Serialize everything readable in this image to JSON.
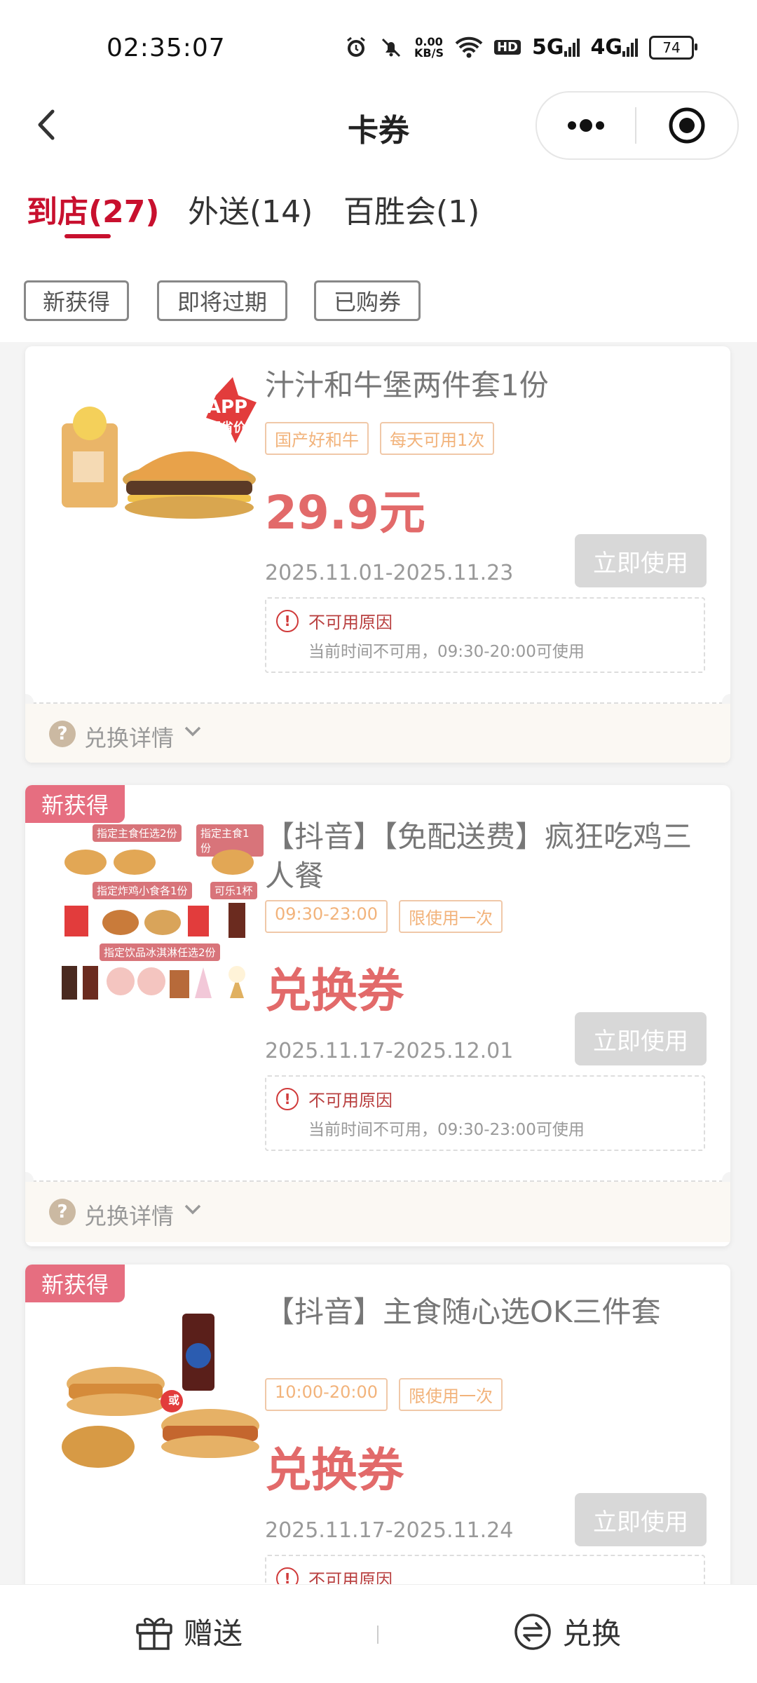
{
  "status_bar": {
    "time": "02:35:07",
    "net_speed_value": "0.00",
    "net_speed_unit": "KB/S",
    "hd_label": "HD",
    "net_5g": "5G",
    "net_4g": "4G",
    "battery": "74"
  },
  "nav": {
    "title": "卡券"
  },
  "tabs": [
    {
      "label": "到店(27)",
      "active": true
    },
    {
      "label": "外送(14)",
      "active": false
    },
    {
      "label": "百胜会(1)",
      "active": false
    }
  ],
  "filters": [
    "新获得",
    "即将过期",
    "已购券"
  ],
  "coupons": [
    {
      "badge": "",
      "title": "汁汁和牛堡两件套1份",
      "tags": [
        "国产好和牛",
        "每天可用1次"
      ],
      "price": "29.9元",
      "date": "2025.11.01-2025.11.23",
      "button": "立即使用",
      "reason_title": "不可用原因",
      "reason_desc": "当前时间不可用，09:30-20:00可使用",
      "detail": "兑换详情",
      "app_badge_line1": "APP",
      "app_badge_line2": "超省价"
    },
    {
      "badge": "新获得",
      "title": "【抖音】【免配送费】疯狂吃鸡三人餐",
      "tags": [
        "09:30-23:00",
        "限使用一次"
      ],
      "price": "兑换券",
      "date": "2025.11.17-2025.12.01",
      "button": "立即使用",
      "reason_title": "不可用原因",
      "reason_desc": "当前时间不可用，09:30-23:00可使用",
      "detail": "兑换详情",
      "img_labels": [
        "指定主食任选2份",
        "指定主食1份",
        "指定炸鸡小食各1份",
        "可乐1杯",
        "指定饮品冰淇淋任选2份"
      ]
    },
    {
      "badge": "新获得",
      "title": "【抖音】主食随心选OK三件套",
      "tags": [
        "10:00-20:00",
        "限使用一次"
      ],
      "price": "兑换券",
      "date": "2025.11.17-2025.11.24",
      "button": "立即使用",
      "reason_title": "不可用原因",
      "img_or": "或"
    }
  ],
  "bottom": {
    "gift_label": "赠送",
    "exchange_label": "兑换"
  },
  "colors": {
    "accent": "#c8102e",
    "price": "#e26a6a",
    "tag": "#f2b37b",
    "badge": "#e66e80"
  }
}
